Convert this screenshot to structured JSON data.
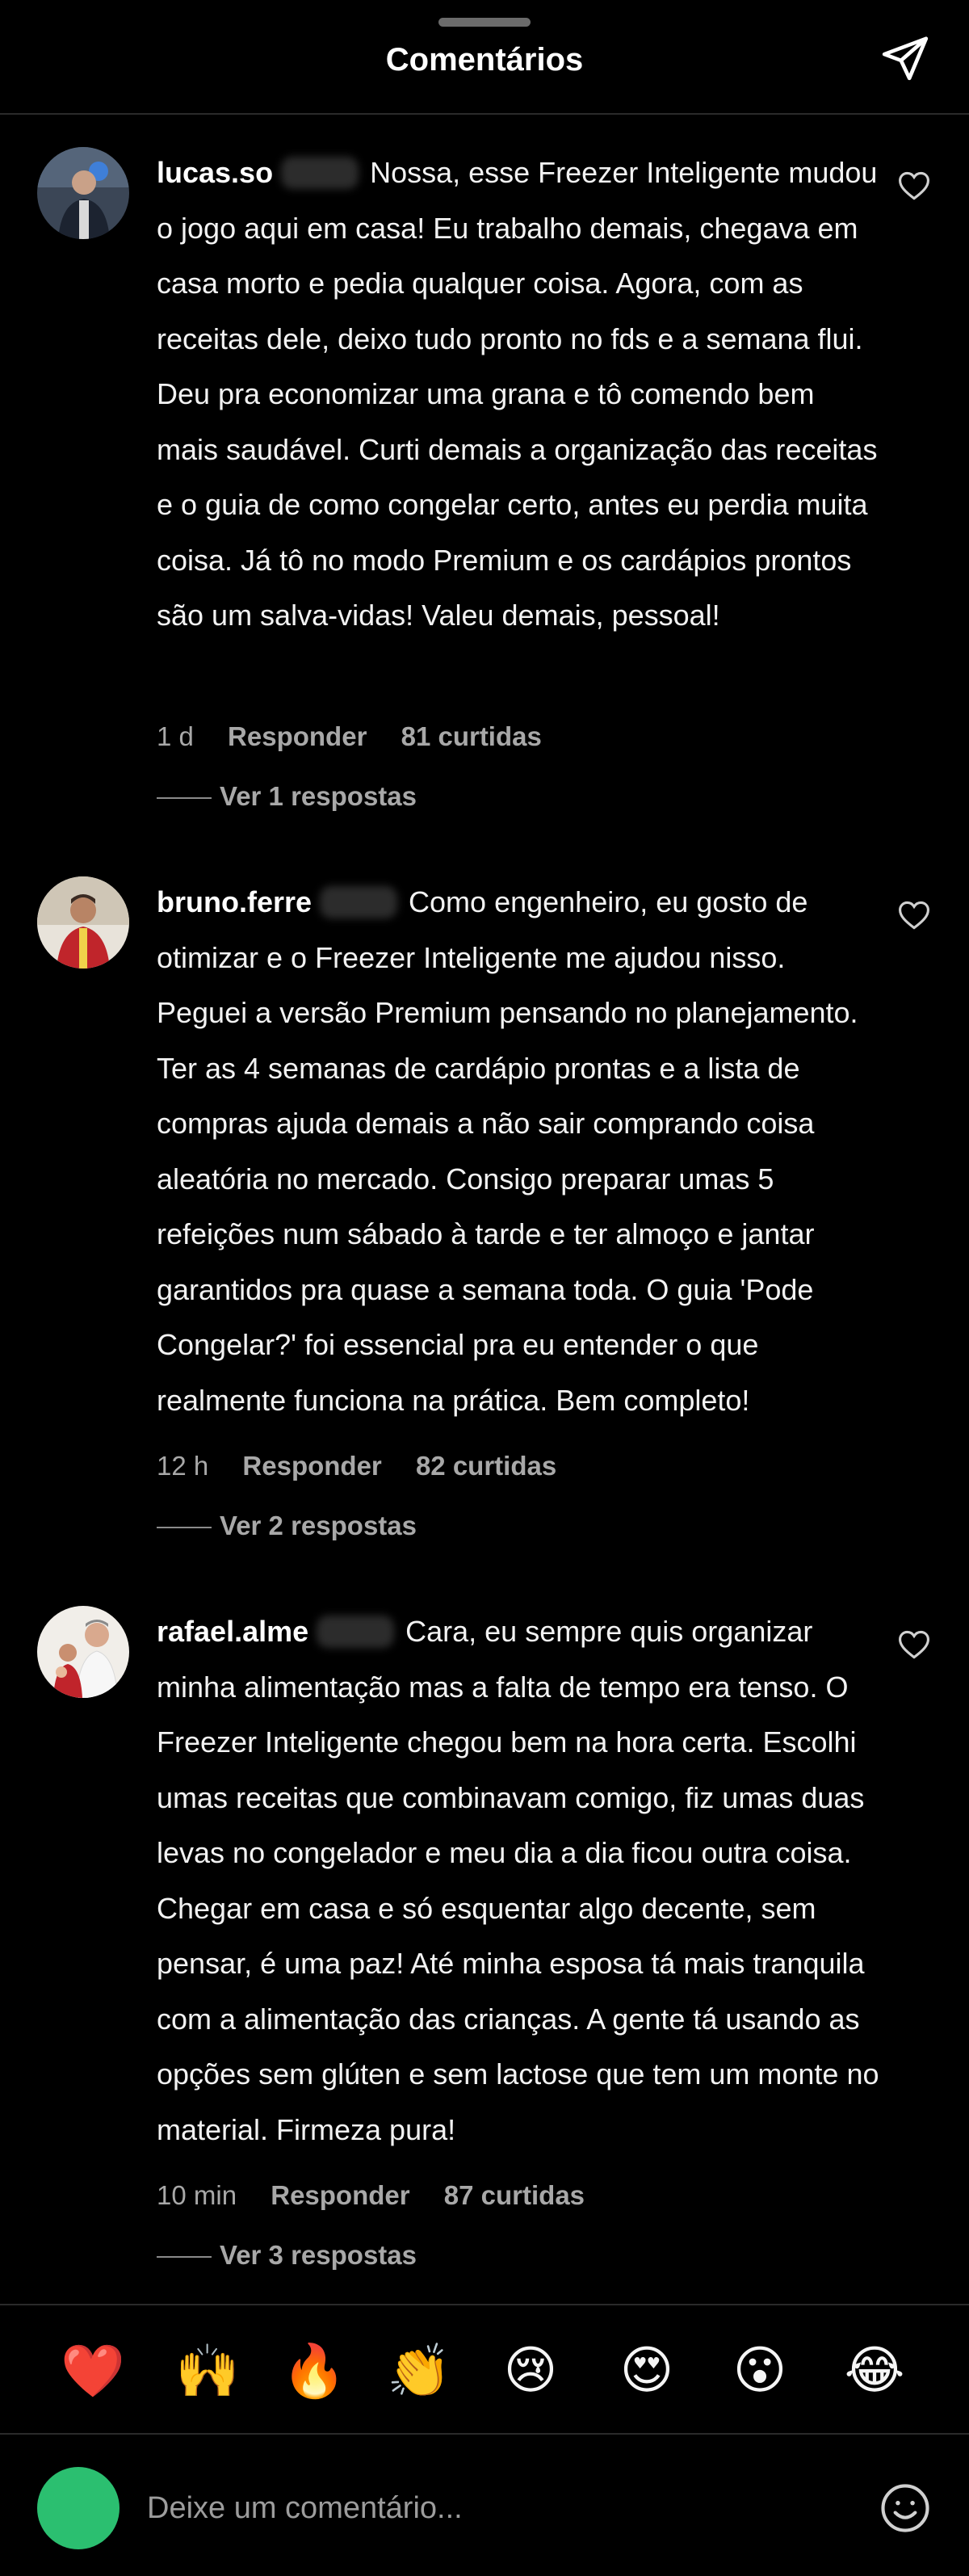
{
  "header": {
    "title": "Comentários"
  },
  "comments": [
    {
      "username": "lucas.so",
      "text": "Nossa, esse Freezer Inteligente mudou o jogo aqui em casa! Eu trabalho demais, chegava em casa morto e pedia qualquer coisa. Agora, com as receitas dele, deixo tudo pronto no fds e a semana flui. Deu pra economizar uma grana e tô comendo bem mais saudável. Curti demais a organização das receitas e o guia de como congelar certo, antes eu perdia muita coisa. Já tô no modo Premium e os cardápios prontos são um salva-vidas! Valeu demais, pessoal!",
      "time": "1 d",
      "reply_label": "Responder",
      "likes": "81 curtidas",
      "view_replies": "Ver 1 respostas"
    },
    {
      "username": "bruno.ferre",
      "text": "Como engenheiro, eu gosto de otimizar e o Freezer Inteligente me ajudou nisso. Peguei a versão Premium pensando no planejamento. Ter as 4 semanas de cardápio prontas e a lista de compras ajuda demais a não sair comprando coisa aleatória no mercado. Consigo preparar umas 5 refeições num sábado à tarde e ter almoço e jantar garantidos pra quase a semana toda. O guia 'Pode Congelar?' foi essencial pra eu entender o que realmente funciona na prática. Bem completo!",
      "time": "12 h",
      "reply_label": "Responder",
      "likes": "82 curtidas",
      "view_replies": "Ver 2 respostas"
    },
    {
      "username": "rafael.alme",
      "text": "Cara, eu sempre quis organizar minha alimentação mas a falta de tempo era tenso. O Freezer Inteligente chegou bem na hora certa. Escolhi umas receitas que combinavam comigo, fiz umas duas levas no congelador e meu dia a dia ficou outra coisa. Chegar em casa e só esquentar algo decente, sem pensar, é uma paz! Até minha esposa tá mais tranquila com a alimentação das crianças. A gente tá usando as opções sem glúten e sem lactose que tem um monte no material. Firmeza pura!",
      "time": "10 min",
      "reply_label": "Responder",
      "likes": "87 curtidas",
      "view_replies": "Ver 3 respostas"
    }
  ],
  "reactions": [
    {
      "icon": "heart-emoji",
      "glyph": "❤️"
    },
    {
      "icon": "raising-hands-emoji",
      "glyph": "🙌"
    },
    {
      "icon": "fire-emoji",
      "glyph": "🔥"
    },
    {
      "icon": "clapping-hands-emoji",
      "glyph": "👏"
    },
    {
      "icon": "crying-face-emoji",
      "glyph": "😢"
    },
    {
      "icon": "heart-eyes-emoji",
      "glyph": "😍"
    },
    {
      "icon": "surprised-face-emoji",
      "glyph": "😮"
    },
    {
      "icon": "tears-of-joy-emoji",
      "glyph": "😂"
    }
  ],
  "composer": {
    "placeholder": "Deixe um comentário..."
  },
  "colors": {
    "background": "#000000",
    "muted_text": "#a8a8a8",
    "composer_avatar": "#2bbf70"
  }
}
